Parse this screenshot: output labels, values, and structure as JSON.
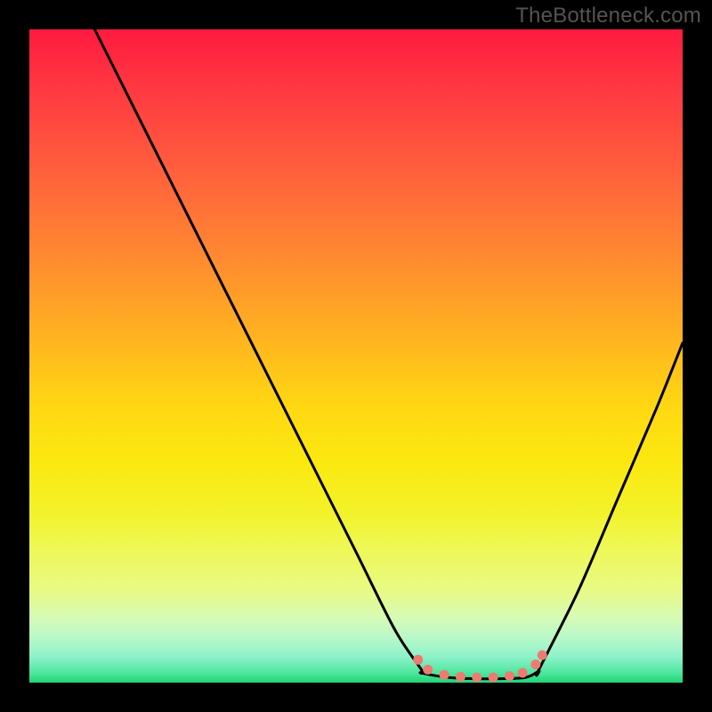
{
  "watermark": "TheBottleneck.com",
  "chart_data": {
    "type": "line",
    "title": "",
    "xlabel": "",
    "ylabel": "",
    "xlim": [
      0,
      100
    ],
    "ylim": [
      0,
      100
    ],
    "gradient_stops": [
      {
        "pct": 0,
        "color": "#ff1a3f"
      },
      {
        "pct": 8,
        "color": "#ff3541"
      },
      {
        "pct": 20,
        "color": "#ff5a3e"
      },
      {
        "pct": 35,
        "color": "#ff8a30"
      },
      {
        "pct": 48,
        "color": "#ffb61f"
      },
      {
        "pct": 58,
        "color": "#ffd812"
      },
      {
        "pct": 66,
        "color": "#fbe80f"
      },
      {
        "pct": 74,
        "color": "#f3f22a"
      },
      {
        "pct": 80,
        "color": "#eef85a"
      },
      {
        "pct": 86,
        "color": "#e8fa86"
      },
      {
        "pct": 90,
        "color": "#d6fbb5"
      },
      {
        "pct": 93,
        "color": "#baf8c8"
      },
      {
        "pct": 96,
        "color": "#8ff2ca"
      },
      {
        "pct": 98.5,
        "color": "#4ee69f"
      },
      {
        "pct": 100,
        "color": "#1fd673"
      }
    ],
    "series": [
      {
        "name": "curve-left",
        "x": [
          10,
          18,
          26,
          34,
          42,
          50,
          56,
          60
        ],
        "y": [
          100,
          84,
          68,
          52,
          36,
          20,
          8,
          2
        ]
      },
      {
        "name": "valley-floor",
        "x": [
          60,
          64,
          68,
          72,
          76,
          78
        ],
        "y": [
          1.5,
          0.8,
          0.6,
          0.6,
          0.8,
          1.8
        ]
      },
      {
        "name": "curve-right",
        "x": [
          78,
          84,
          90,
          96,
          100
        ],
        "y": [
          2,
          14,
          28,
          42,
          52
        ]
      }
    ],
    "markers": {
      "name": "highlight-dots",
      "color": "#ef7b70",
      "points": [
        {
          "x": 59.5,
          "y": 3.5
        },
        {
          "x": 61,
          "y": 2.0
        },
        {
          "x": 63.5,
          "y": 1.2
        },
        {
          "x": 66,
          "y": 0.9
        },
        {
          "x": 68.5,
          "y": 0.8
        },
        {
          "x": 71,
          "y": 0.8
        },
        {
          "x": 73.5,
          "y": 1.0
        },
        {
          "x": 75.5,
          "y": 1.5
        },
        {
          "x": 77.5,
          "y": 2.8
        },
        {
          "x": 78.5,
          "y": 4.2
        }
      ]
    }
  }
}
